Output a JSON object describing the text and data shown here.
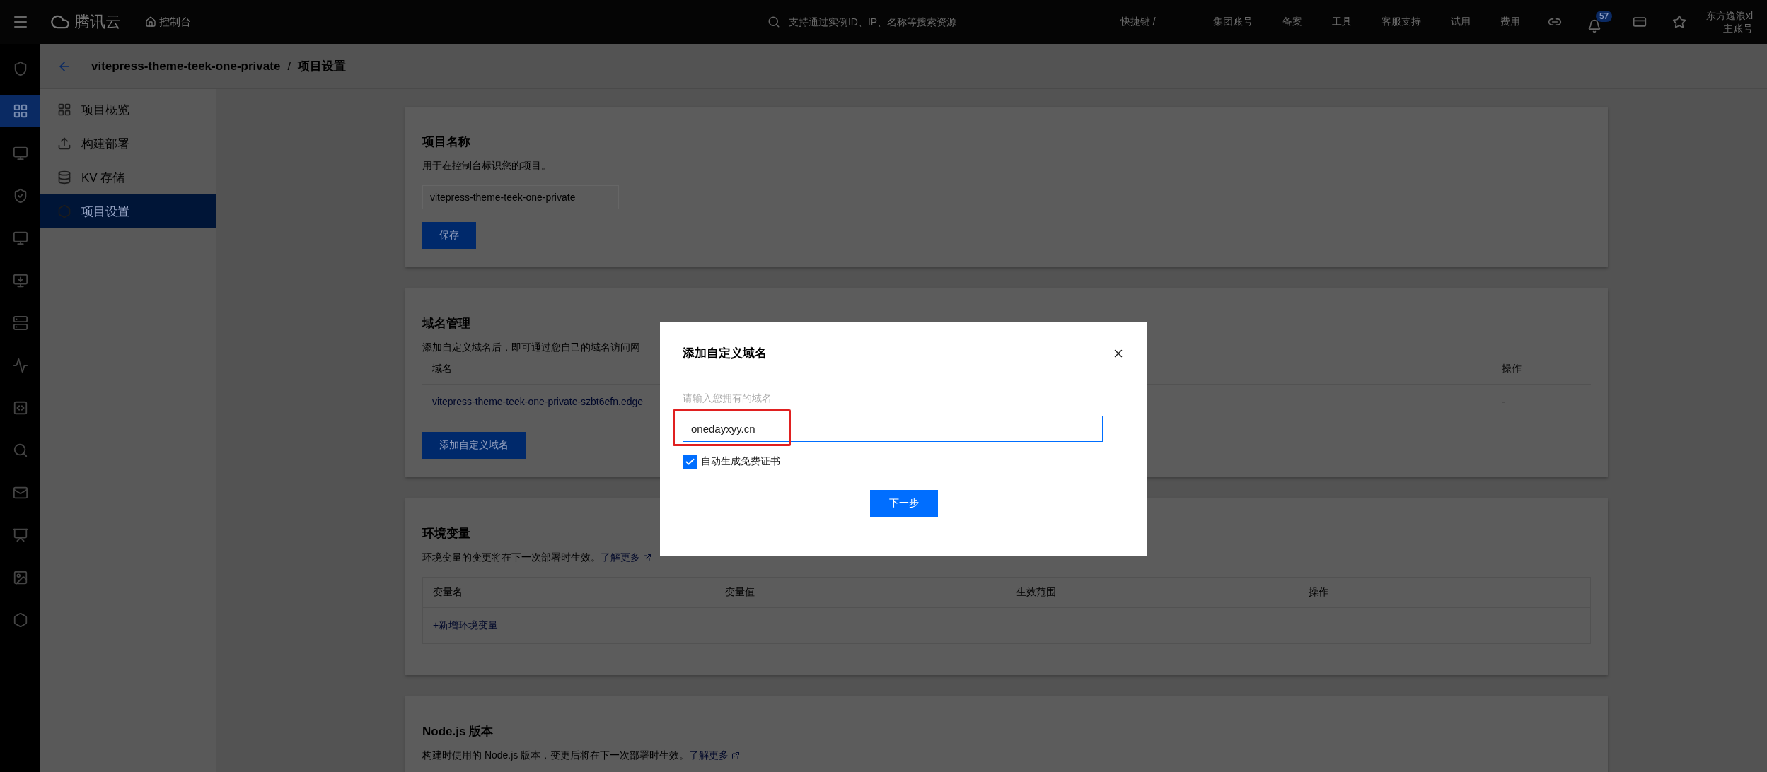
{
  "top_bar": {
    "logo_text": "腾讯云",
    "console_link": "控制台",
    "search_placeholder": "支持通过实例ID、IP、名称等搜索资源",
    "shortcut": "快捷键 /",
    "nav_links": [
      "集团账号",
      "备案",
      "工具",
      "客服支持",
      "试用",
      "费用"
    ],
    "notification_count": "57",
    "user_name": "东方逸浪xl",
    "account_type": "主账号"
  },
  "icon_rail": [
    {
      "kind": "shield",
      "selected": false
    },
    {
      "kind": "grid",
      "selected": true
    },
    {
      "kind": "monitor",
      "selected": false
    },
    {
      "kind": "badge",
      "selected": false
    },
    {
      "kind": "monitor",
      "selected": false
    },
    {
      "kind": "download",
      "selected": false
    },
    {
      "kind": "server",
      "selected": false
    },
    {
      "kind": "activity",
      "selected": false
    },
    {
      "kind": "ip",
      "selected": false
    },
    {
      "kind": "search",
      "selected": false
    },
    {
      "kind": "mail",
      "selected": false
    },
    {
      "kind": "board",
      "selected": false
    },
    {
      "kind": "image",
      "selected": false
    },
    {
      "kind": "hexagon",
      "selected": false
    }
  ],
  "breadcrumb": {
    "project": "vitepress-theme-teek-one-private",
    "separator": "/",
    "page": "项目设置"
  },
  "submenu": [
    {
      "kind": "overview",
      "label": "项目概览",
      "selected": false
    },
    {
      "kind": "deploy",
      "label": "构建部署",
      "selected": false
    },
    {
      "kind": "storage",
      "label": "KV 存储",
      "selected": false
    },
    {
      "kind": "settings",
      "label": "项目设置",
      "selected": true
    }
  ],
  "project_name": {
    "title": "项目名称",
    "description": "用于在控制台标识您的项目。",
    "value": "vitepress-theme-teek-one-private",
    "save_button": "保存"
  },
  "domains": {
    "title": "域名管理",
    "description": "添加自定义域名后，即可通过您自己的域名访问网",
    "columns": [
      "域名",
      "操作"
    ],
    "rows": [
      {
        "domain": "vitepress-theme-teek-one-private-szbt6efn.edge",
        "action": "-"
      }
    ],
    "add_button": "添加自定义域名"
  },
  "env_vars": {
    "title": "环境变量",
    "description": "环境变量的变更将在下一次部署时生效。",
    "learn_more": "了解更多",
    "columns": [
      "变量名",
      "变量值",
      "生效范围",
      "操作"
    ],
    "add_link": "+新增环境变量"
  },
  "nodejs": {
    "title": "Node.js 版本",
    "description": "构建时使用的 Node.js 版本，变更后将在下一次部署时生效。",
    "learn_more": "了解更多"
  },
  "dialog": {
    "title": "添加自定义域名",
    "label": "请输入您拥有的域名",
    "value": "onedayxyy.cn",
    "auto_cert": {
      "label": "自动生成免费证书",
      "checked": true
    },
    "next_button": "下一步"
  }
}
